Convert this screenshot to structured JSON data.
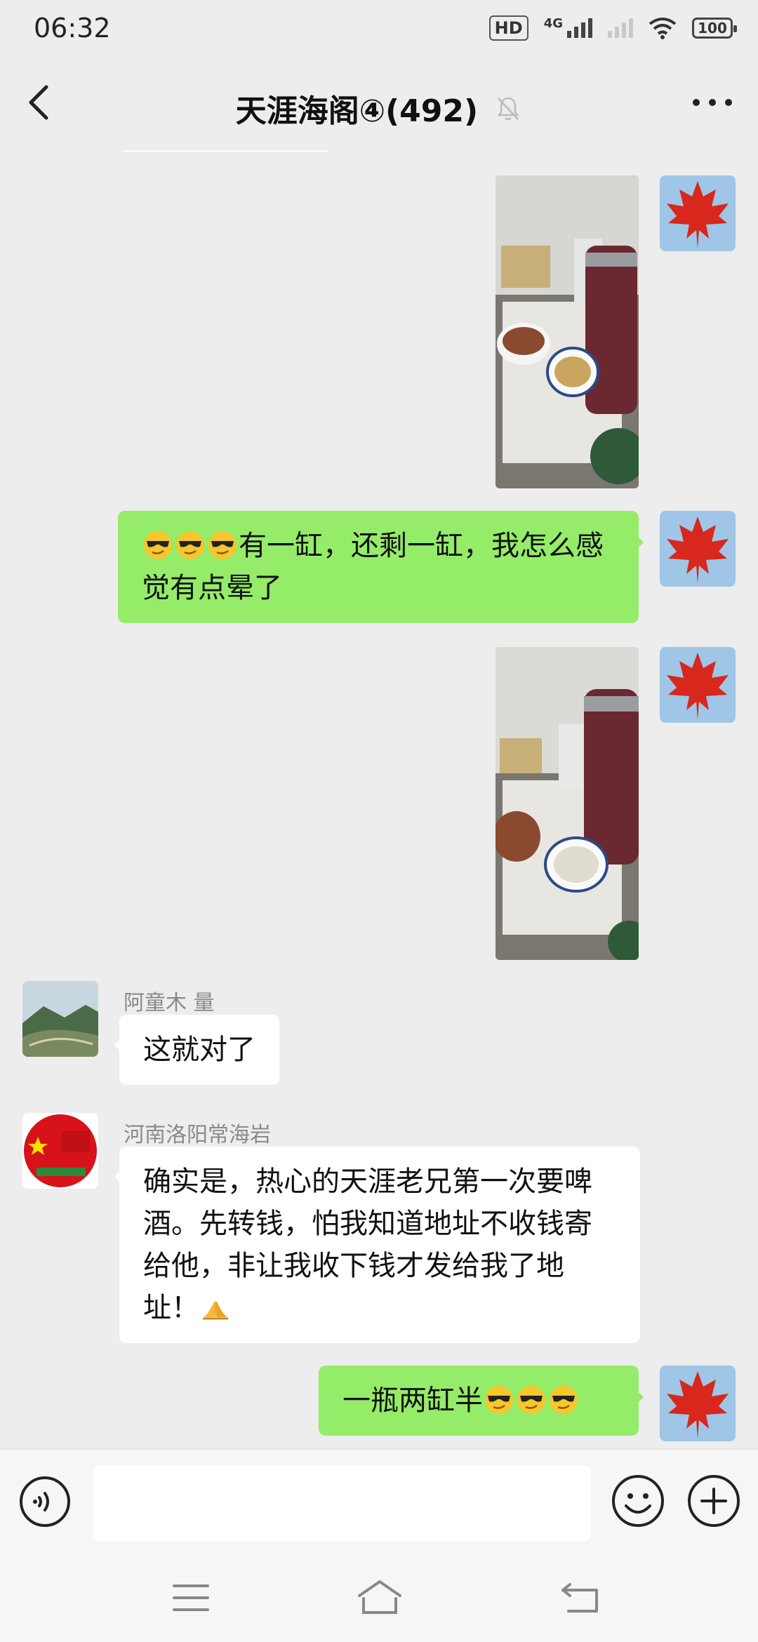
{
  "status_bar": {
    "time": "06:32",
    "hd_label": "HD",
    "network_label": "4G",
    "battery_level": "100"
  },
  "header": {
    "title": "天涯海阁④(492)"
  },
  "messages": [
    {
      "type": "image",
      "side": "right",
      "content": "photo-table-with-pot-and-drinks"
    },
    {
      "type": "text",
      "side": "right",
      "text": "有一缸，还剩一缸，我怎么感觉有点晕了",
      "emojis": [
        "cool-face",
        "cool-face",
        "cool-face"
      ]
    },
    {
      "type": "image",
      "side": "right",
      "content": "photo-table-with-pot-and-drinks-2"
    },
    {
      "type": "text",
      "side": "left",
      "sender": "阿童木 量",
      "text": "这就对了"
    },
    {
      "type": "text",
      "side": "left",
      "sender": "河南洛阳常海岩",
      "text": "确实是，热心的天涯老兄第一次要啤酒。先转钱，怕我知道地址不收钱寄给他，非让我收下钱才发给我了地址！",
      "emojis": [
        "folded-hands"
      ]
    },
    {
      "type": "text",
      "side": "right",
      "text": "一瓶两缸半",
      "emojis": [
        "cool-face",
        "cool-face",
        "cool-face"
      ]
    }
  ],
  "input_bar": {
    "placeholder": ""
  },
  "colors": {
    "background": "#ededed",
    "bubble_self": "#95ec69",
    "bubble_other": "#ffffff"
  }
}
